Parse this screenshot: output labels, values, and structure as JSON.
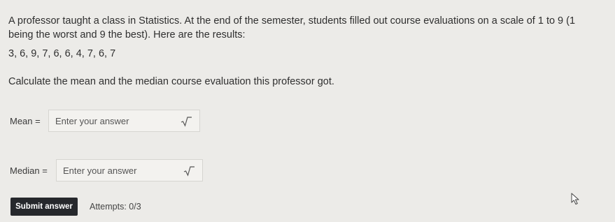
{
  "question": {
    "text": "A professor taught a class in Statistics. At the end of the semester, students filled out course evaluations on a scale of 1 to 9 (1 being the worst and 9 the best). Here are the results:",
    "data_values": "3, 6, 9, 7, 6, 6, 4, 7, 6, 7",
    "instruction": "Calculate the mean and the median course evaluation this professor got."
  },
  "answers": [
    {
      "label": "Mean =",
      "value": "",
      "placeholder": "Enter your answer",
      "icon": "square-root-icon"
    },
    {
      "label": "Median =",
      "value": "",
      "placeholder": "Enter your answer",
      "icon": "square-root-icon"
    }
  ],
  "submit": {
    "label": "Submit answer"
  },
  "attempts": {
    "text": "Attempts: 0/3"
  },
  "colors": {
    "background": "#ecebe8",
    "button": "#26282c",
    "text": "#2f2f2f"
  }
}
